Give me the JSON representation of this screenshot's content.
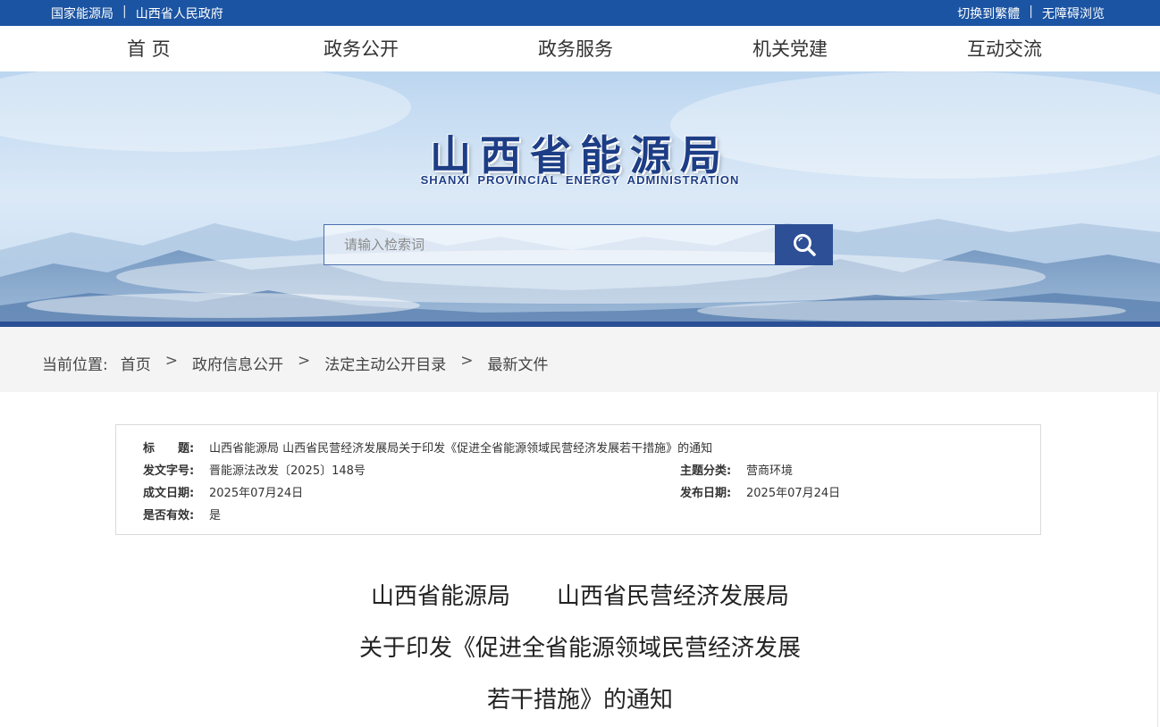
{
  "topbar": {
    "left_links": [
      "国家能源局",
      "山西省人民政府"
    ],
    "right_links": [
      "切换到繁體",
      "无障碍浏览"
    ],
    "separator": "|"
  },
  "nav": {
    "items": [
      "首 页",
      "政务公开",
      "政务服务",
      "机关党建",
      "互动交流"
    ]
  },
  "banner": {
    "title_cn": "山西省能源局",
    "title_en": "SHANXI PROVINCIAL ENERGY ADMINISTRATION",
    "search_placeholder": "请输入检索词",
    "search_icon": "search-icon"
  },
  "breadcrumb": {
    "label": "当前位置:",
    "items": [
      "首页",
      "政府信息公开",
      "法定主动公开目录",
      "最新文件"
    ],
    "separator": ">"
  },
  "meta": {
    "title_label": "标　　题:",
    "title_value": "山西省能源局 山西省民营经济发展局关于印发《促进全省能源领域民营经济发展若干措施》的通知",
    "docno_label": "发文字号:",
    "docno_value": "晋能源法改发〔2025〕148号",
    "topic_label": "主题分类:",
    "topic_value": "营商环境",
    "made_label": "成文日期:",
    "made_value": "2025年07月24日",
    "pub_label": "发布日期:",
    "pub_value": "2025年07月24日",
    "valid_label": "是否有效:",
    "valid_value": "是"
  },
  "article": {
    "title_line1": "山西省能源局　　山西省民营经济发展局",
    "title_line2": "关于印发《促进全省能源领域民营经济发展",
    "title_line3": "若干措施》的通知"
  },
  "colors": {
    "topbar": "#1b54a2",
    "accent": "#2c4f96",
    "logo": "#1d3e86"
  }
}
